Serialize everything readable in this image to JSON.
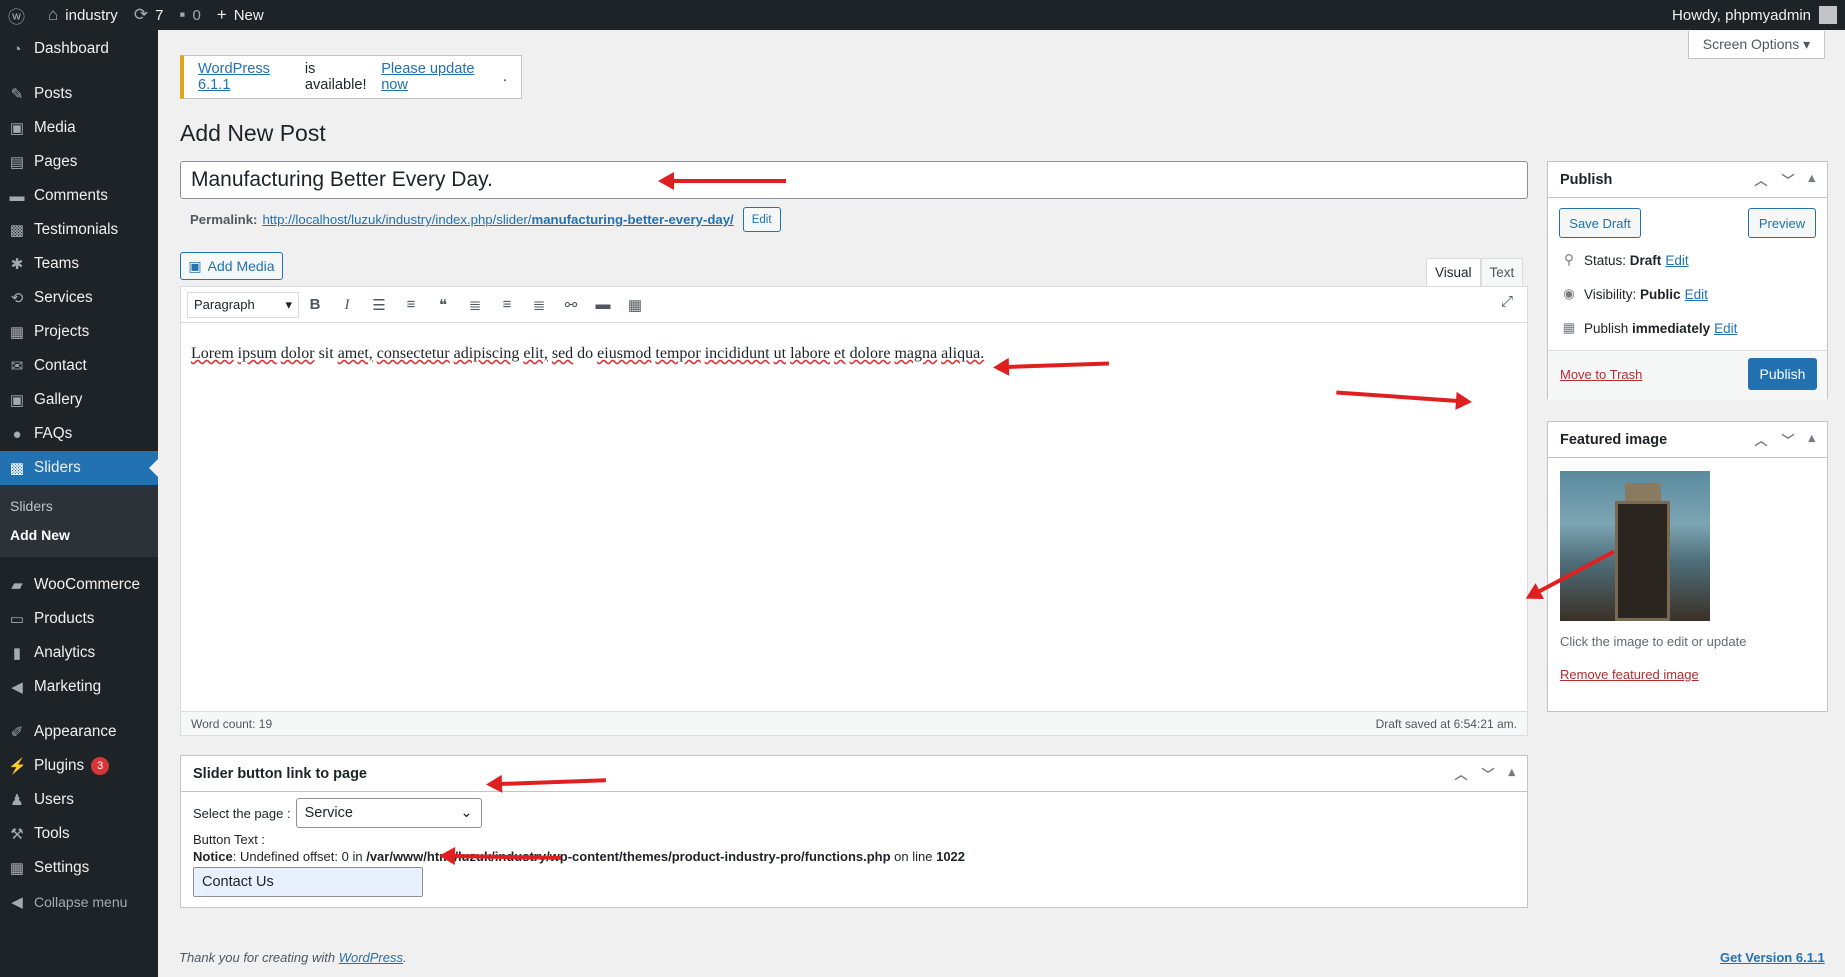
{
  "adminbar": {
    "site": "industry",
    "updates": "7",
    "comments": "0",
    "new_label": "New",
    "howdy": "Howdy, phpmyadmin"
  },
  "sidebar": {
    "items": [
      {
        "label": "Dashboard",
        "icon": "dashboard-icon"
      },
      {
        "label": "Posts",
        "icon": "pin-icon"
      },
      {
        "label": "Media",
        "icon": "media-icon"
      },
      {
        "label": "Pages",
        "icon": "pages-icon"
      },
      {
        "label": "Comments",
        "icon": "comments-icon"
      },
      {
        "label": "Testimonials",
        "icon": "testimonials-icon"
      },
      {
        "label": "Teams",
        "icon": "teams-icon"
      },
      {
        "label": "Services",
        "icon": "services-icon"
      },
      {
        "label": "Projects",
        "icon": "projects-icon"
      },
      {
        "label": "Contact",
        "icon": "contact-icon"
      },
      {
        "label": "Gallery",
        "icon": "gallery-icon"
      },
      {
        "label": "FAQs",
        "icon": "faqs-icon"
      },
      {
        "label": "Sliders",
        "icon": "sliders-icon"
      },
      {
        "label": "WooCommerce",
        "icon": "woocommerce-icon"
      },
      {
        "label": "Products",
        "icon": "products-icon"
      },
      {
        "label": "Analytics",
        "icon": "analytics-icon"
      },
      {
        "label": "Marketing",
        "icon": "marketing-icon"
      },
      {
        "label": "Appearance",
        "icon": "appearance-icon"
      },
      {
        "label": "Plugins",
        "icon": "plugins-icon",
        "badge": "3"
      },
      {
        "label": "Users",
        "icon": "users-icon"
      },
      {
        "label": "Tools",
        "icon": "tools-icon"
      },
      {
        "label": "Settings",
        "icon": "settings-icon"
      }
    ],
    "submenu": [
      "Sliders",
      "Add New"
    ],
    "collapse": "Collapse menu"
  },
  "screen_options": "Screen Options ▾",
  "notice": {
    "version_link": "WordPress 6.1.1",
    "middle": "is available!",
    "update_link": "Please update now",
    "end": "."
  },
  "page_title": "Add New Post",
  "post_title": "Manufacturing Better Every Day.",
  "permalink": {
    "label": "Permalink:",
    "url_base": "http://localhost/luzuk/industry/index.php/slider/",
    "slug": "manufacturing-better-every-day/",
    "edit": "Edit"
  },
  "editor": {
    "add_media": "Add Media",
    "tab_visual": "Visual",
    "tab_text": "Text",
    "format": "Paragraph",
    "content_words": [
      "Lorem",
      "ipsum",
      "dolor",
      "sit",
      "amet,",
      "consectetur",
      "adipiscing",
      "elit,",
      "sed",
      "do",
      "eiusmod",
      "tempor",
      "incididunt",
      "ut",
      "labore",
      "et",
      "dolore",
      "magna",
      "aliqua."
    ],
    "word_count": "Word count: 19",
    "draft_saved": "Draft saved at 6:54:21 am."
  },
  "slider_box": {
    "title": "Slider button link to page",
    "select_label": "Select the page :",
    "selected_page": "Service",
    "button_text_label": "Button Text :",
    "notice_label": "Notice",
    "notice_text": ": Undefined offset: 0 in ",
    "notice_path": "/var/www/html/luzuk/industry/wp-content/themes/product-industry-pro/functions.php",
    "notice_online": " on line ",
    "notice_line": "1022",
    "button_text_value": "Contact Us"
  },
  "publish": {
    "title": "Publish",
    "save_draft": "Save Draft",
    "preview": "Preview",
    "status_label": "Status:",
    "status_value": "Draft",
    "visibility_label": "Visibility:",
    "visibility_value": "Public",
    "publish_label": "Publish",
    "publish_value": "immediately",
    "edit": "Edit",
    "trash": "Move to Trash",
    "publish_button": "Publish"
  },
  "featured": {
    "title": "Featured image",
    "hint": "Click the image to edit or update",
    "remove": "Remove featured image"
  },
  "footer": {
    "thanks": "Thank you for creating with",
    "wp_link": "WordPress",
    "period": ".",
    "version": "Get Version 6.1.1"
  }
}
